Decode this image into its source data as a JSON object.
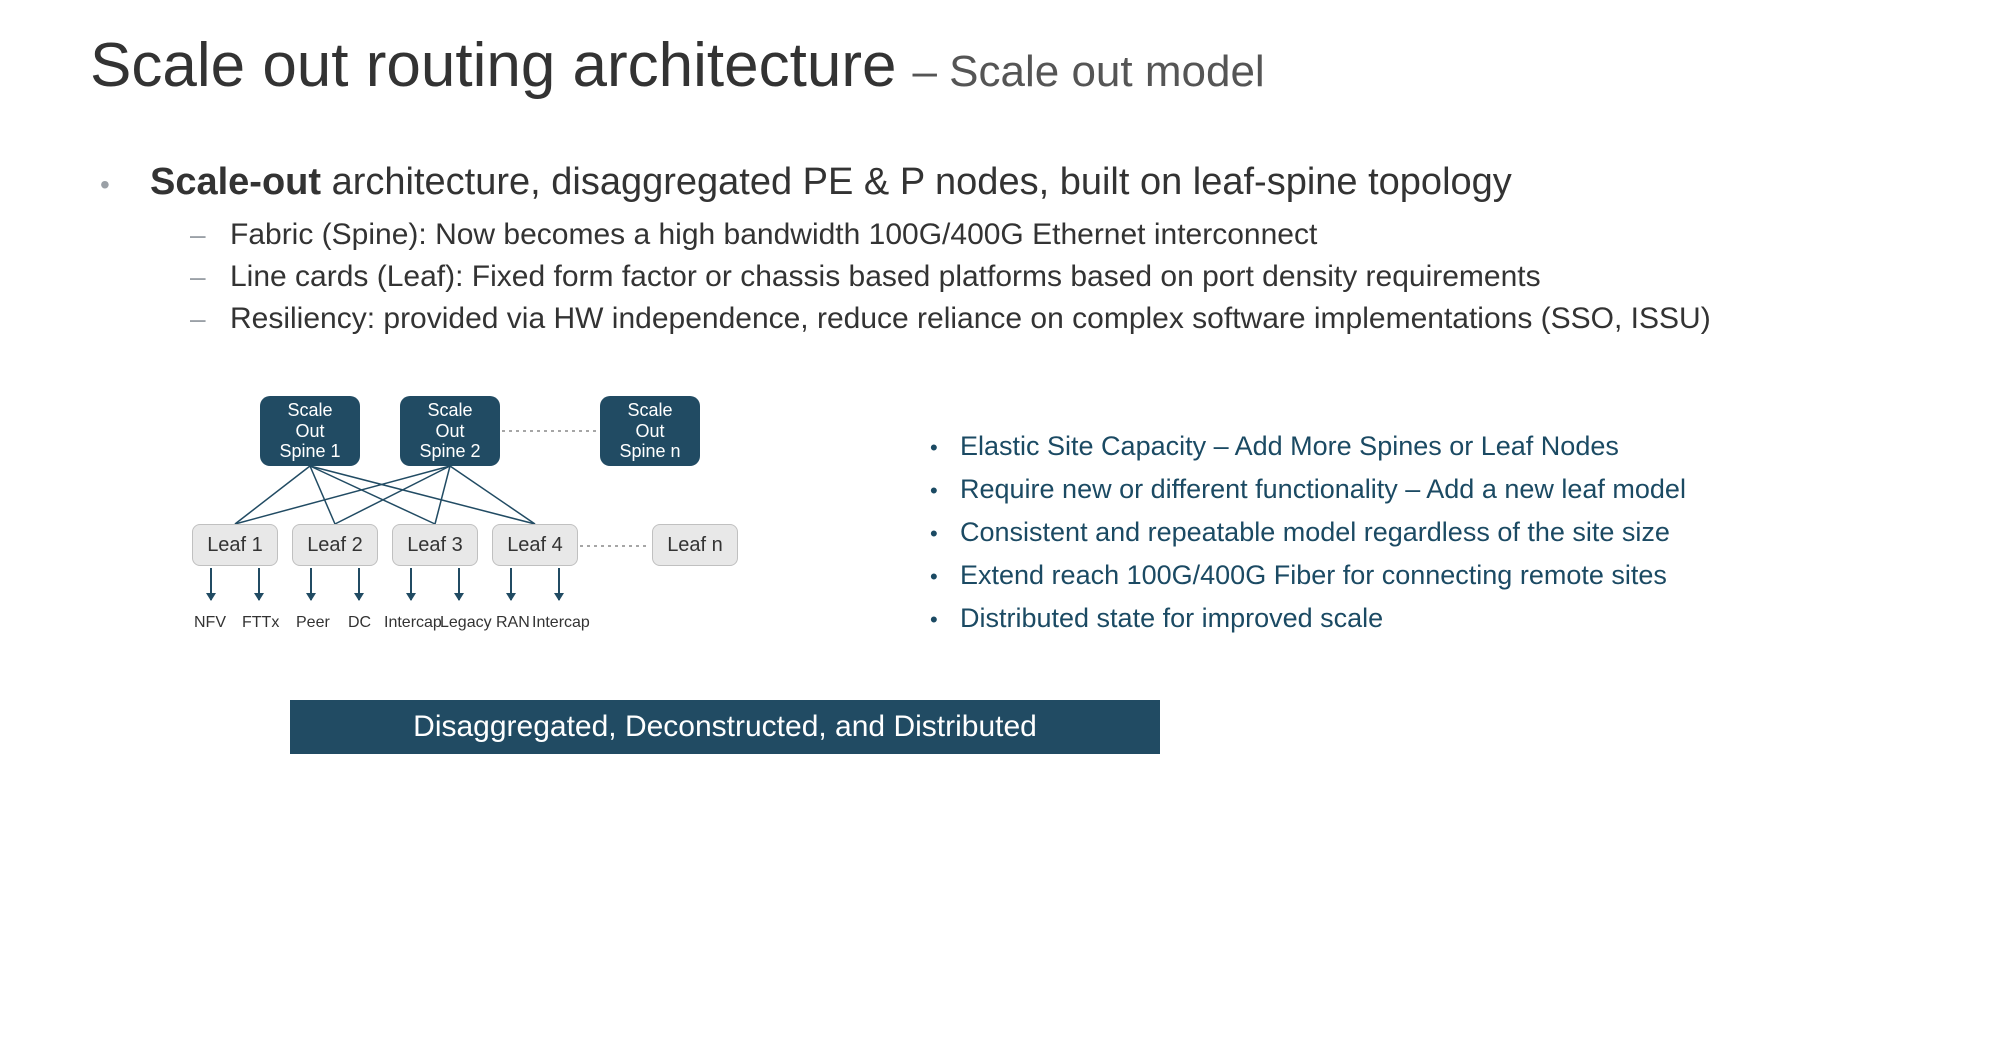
{
  "title": {
    "main": "Scale out routing architecture",
    "sub": "– Scale out model"
  },
  "main_bullet": {
    "bold_lead": "Scale-out",
    "rest": " architecture, disaggregated PE & P nodes, built on leaf-spine topology"
  },
  "sub_bullets": [
    "Fabric (Spine): Now becomes a high bandwidth 100G/400G Ethernet interconnect",
    "Line cards (Leaf): Fixed form factor or chassis based platforms based on port density requirements",
    "Resiliency: provided via HW independence, reduce reliance on complex software implementations (SSO, ISSU)"
  ],
  "diagram": {
    "spines": [
      "Scale\nOut\nSpine 1",
      "Scale\nOut\nSpine 2",
      "Scale\nOut\nSpine n"
    ],
    "leaves": [
      "Leaf 1",
      "Leaf 2",
      "Leaf 3",
      "Leaf 4",
      "Leaf n"
    ],
    "down_labels": [
      "NFV",
      "FTTx",
      "Peer",
      "DC",
      "Intercap",
      "Legacy",
      "RAN",
      "Intercap"
    ]
  },
  "benefits": [
    "Elastic Site Capacity – Add More Spines or Leaf Nodes",
    "Require new or different functionality – Add a new leaf model",
    "Consistent and repeatable model regardless of the site size",
    "Extend reach 100G/400G Fiber for connecting remote sites",
    "Distributed state for improved scale"
  ],
  "banner": "Disaggregated, Deconstructed, and Distributed"
}
